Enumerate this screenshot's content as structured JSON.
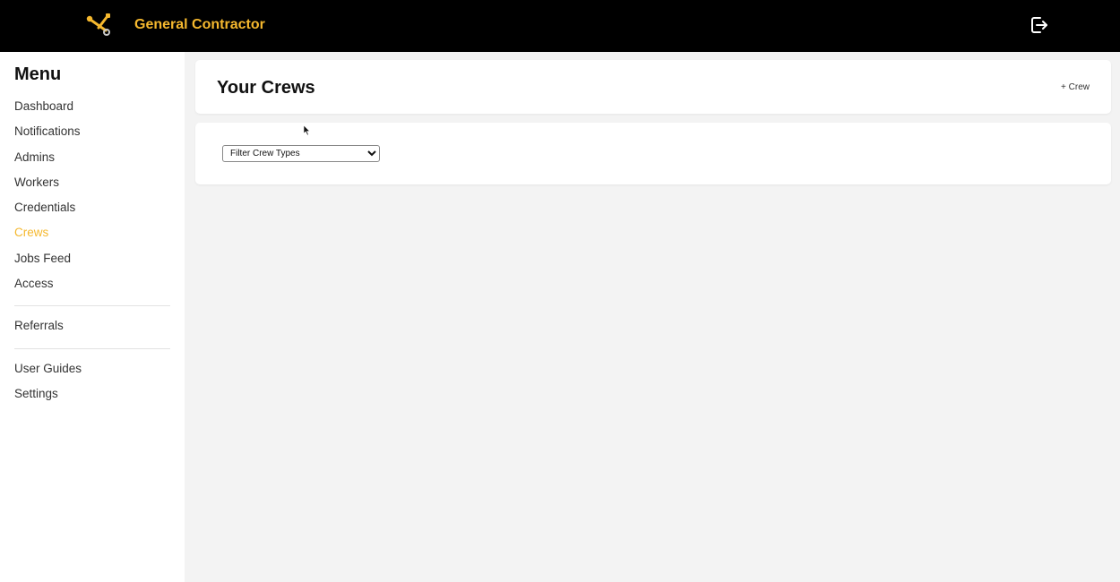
{
  "app": {
    "title": "General Contractor",
    "brand_color": "#f5b82e",
    "logo_icon": "crossed-tools-icon",
    "logout_icon": "logout-icon"
  },
  "sidebar": {
    "title": "Menu",
    "active_item": "Crews",
    "groups": [
      [
        "Dashboard",
        "Notifications",
        "Admins",
        "Workers",
        "Credentials",
        "Crews",
        "Jobs Feed",
        "Access"
      ],
      [
        "Referrals"
      ],
      [
        "User Guides",
        "Settings"
      ]
    ]
  },
  "main": {
    "title": "Your Crews",
    "add_button_label": "+ Crew",
    "filter": {
      "selected": "Filter Crew Types"
    }
  }
}
